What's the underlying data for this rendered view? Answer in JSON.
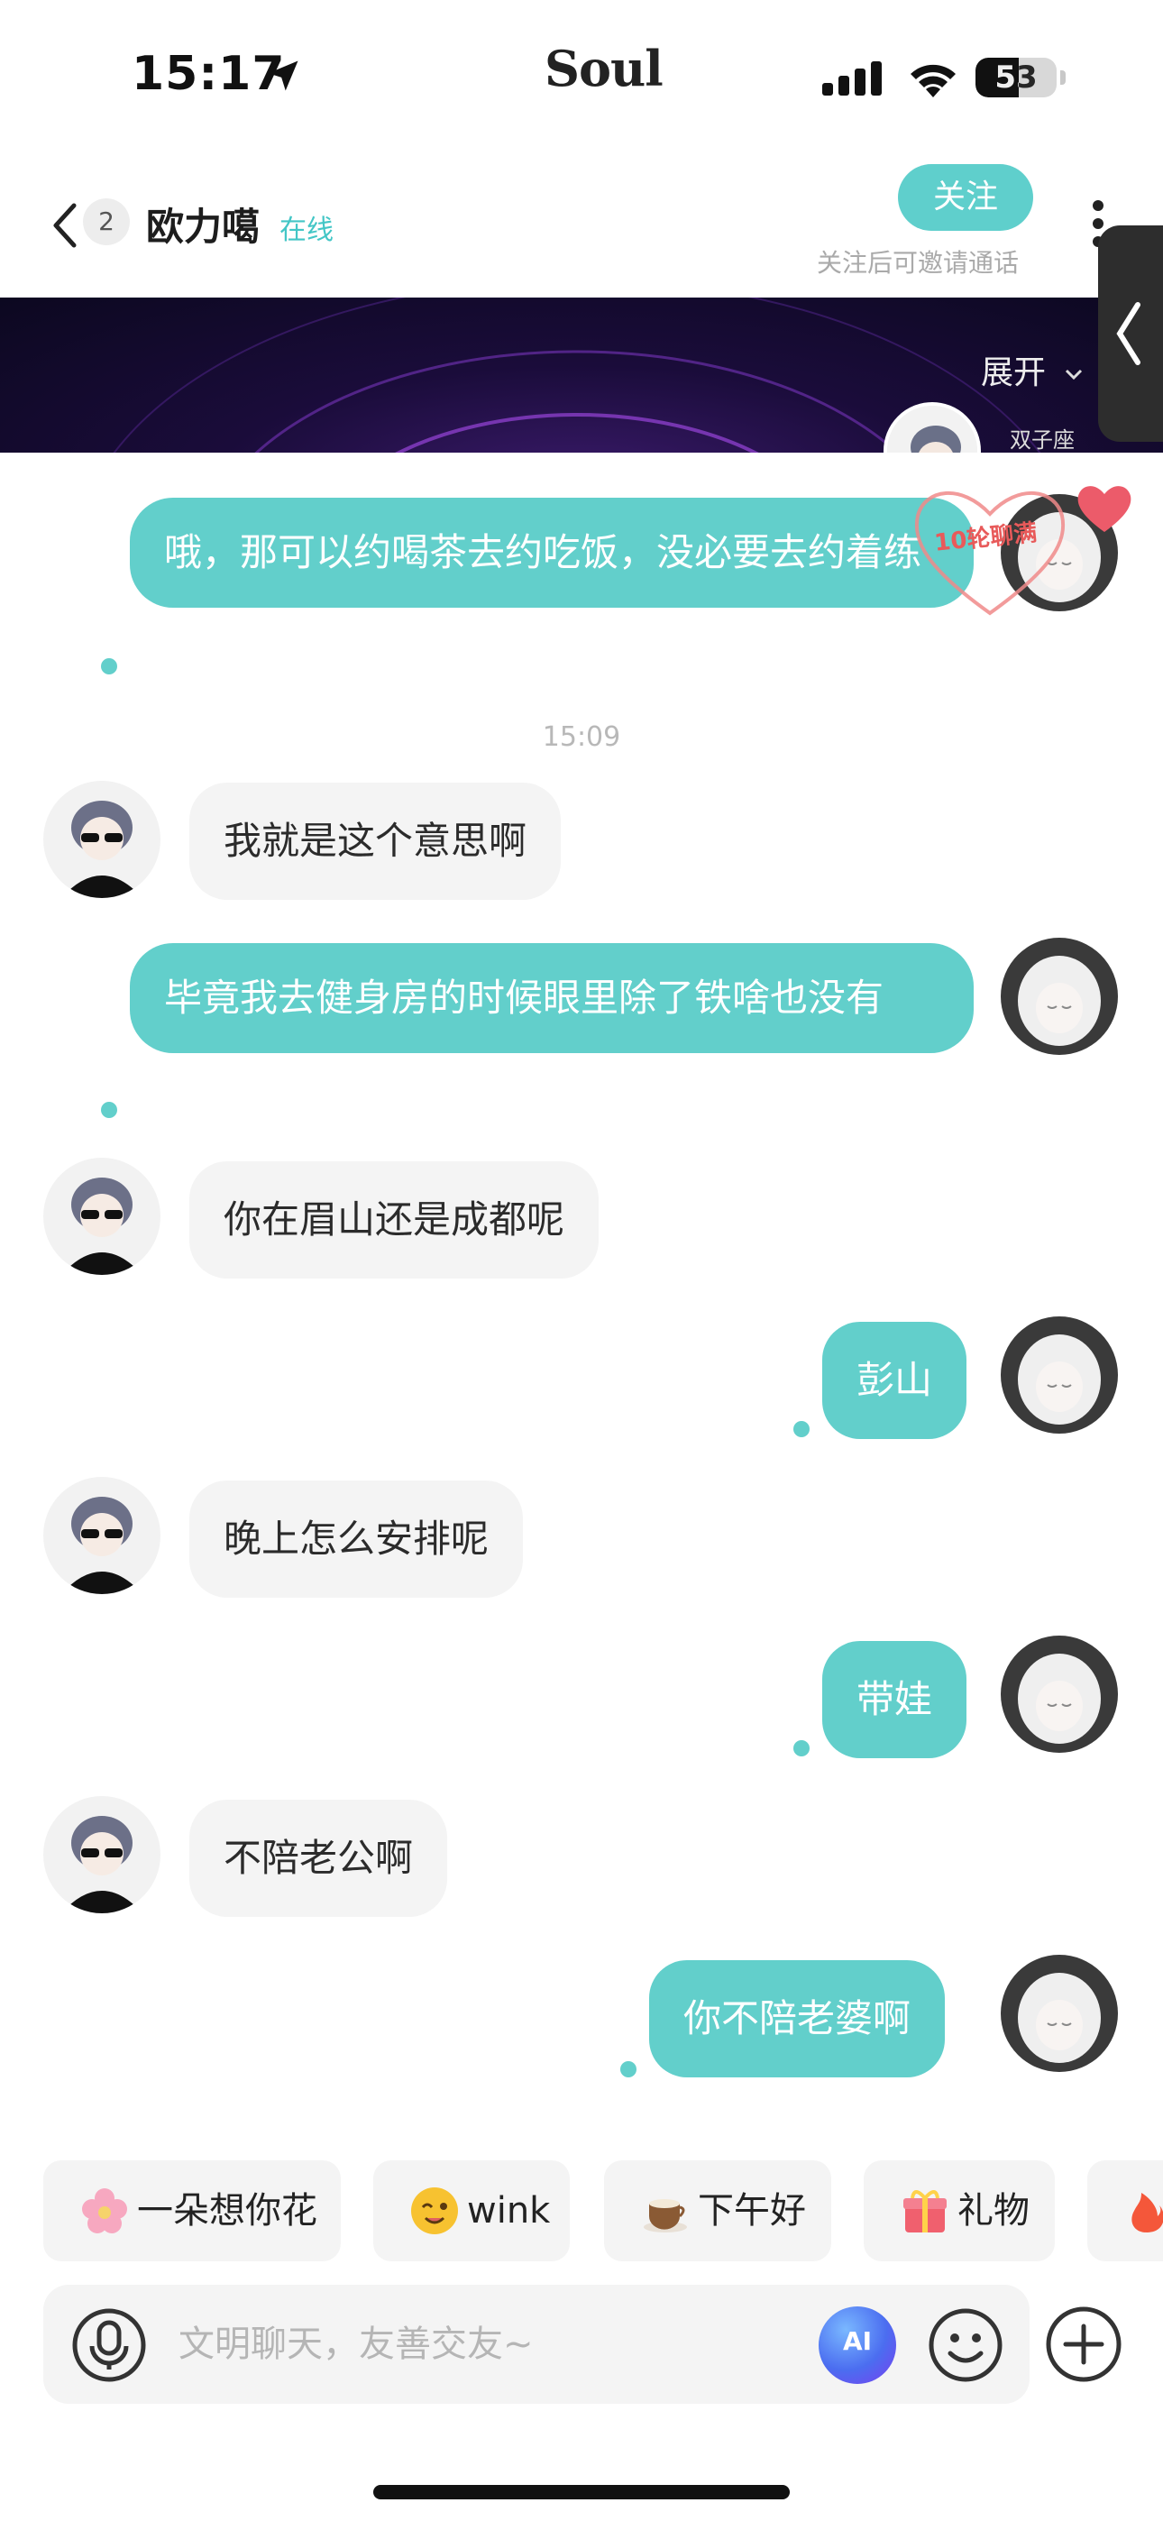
{
  "status_bar": {
    "time": "15:17",
    "brand": "Soul",
    "battery_text": "53",
    "battery_level": 0.53
  },
  "header": {
    "unread_count": "2",
    "name": "欧力噶",
    "online": "在线",
    "follow_label": "关注",
    "follow_hint": "关注后可邀请通话"
  },
  "banner": {
    "expand_label": "展开",
    "zodiac": "双子座"
  },
  "overlay": {
    "heart_text": "10轮聊满"
  },
  "messages": {
    "m1": "哦，那可以约喝茶去约吃饭，没必要去约着练",
    "timestamp": "15:09",
    "m2": "我就是这个意思啊",
    "m3": "毕竟我去健身房的时候眼里除了铁啥也没有",
    "m4": "你在眉山还是成都呢",
    "m5": "彭山",
    "m6": "晚上怎么安排呢",
    "m7": "带娃",
    "m8": "不陪老公啊",
    "m9": "你不陪老婆啊"
  },
  "quick_replies": [
    {
      "label": "一朵想你花",
      "icon": "flower-icon"
    },
    {
      "label": "wink",
      "icon": "wink-emoji-icon"
    },
    {
      "label": "下午好",
      "icon": "coffee-icon"
    },
    {
      "label": "礼物",
      "icon": "gift-icon"
    },
    {
      "label": "",
      "icon": "fire-icon"
    }
  ],
  "input": {
    "placeholder": "文明聊天，友善交友~",
    "ai_label": "AI"
  },
  "colors": {
    "accent": "#62cfcb",
    "bubble_other": "#f4f4f4",
    "banner_dark": "#1a0c3a"
  }
}
